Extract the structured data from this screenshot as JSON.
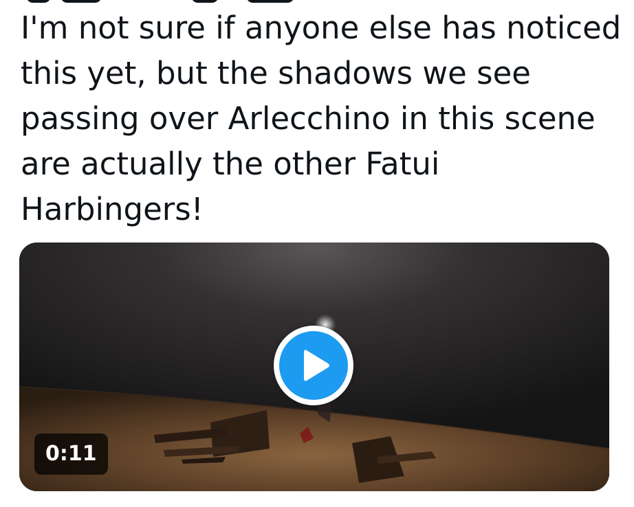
{
  "tweet": {
    "text": "I'm not sure if anyone else has noticed\nthis yet, but the shadows we see\npassing over Arlecchino in this scene\nare actually the other Fatui\nHarbingers!"
  },
  "media": {
    "type": "video",
    "duration": "0:11",
    "play_icon": "play-icon"
  },
  "colors": {
    "text": "#0f1419",
    "accent": "#1d9bf0",
    "video_background": "#1b1a1a",
    "floor": "#6b4a2e"
  }
}
